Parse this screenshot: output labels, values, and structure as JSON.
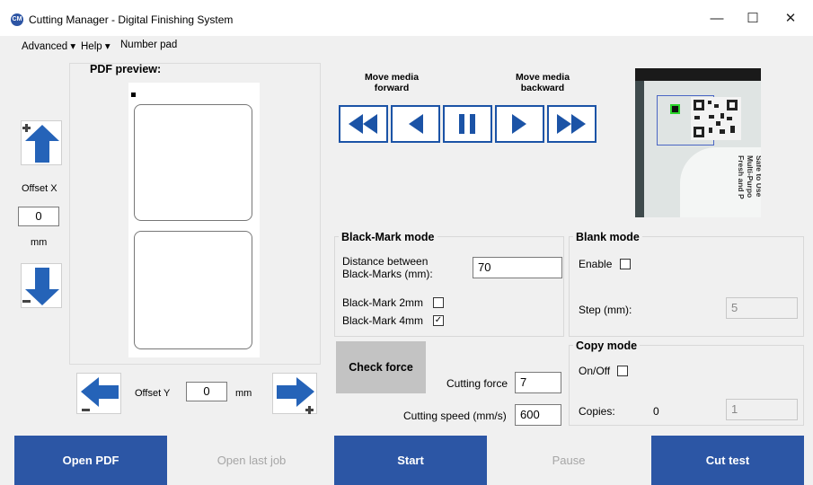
{
  "window": {
    "app_icon_text": "CM",
    "title": "Cutting Manager - Digital Finishing System",
    "minimize": "—",
    "maximize": "☐",
    "close": "✕"
  },
  "menu": {
    "advanced": "Advanced ▾",
    "help": "Help ▾",
    "number_pad": "Number pad"
  },
  "preview": {
    "label": "PDF preview:"
  },
  "offset_x": {
    "label": "Offset X",
    "value": "0",
    "unit": "mm"
  },
  "offset_y": {
    "label": "Offset Y",
    "value": "0",
    "unit": "mm"
  },
  "media": {
    "forward_label": "Move media\nforward",
    "backward_label": "Move media\nbackward"
  },
  "camera": {
    "sticker_text": "Safe to Use\nMulti-Purpo\nFresh and P"
  },
  "blackmark": {
    "title": "Black-Mark mode",
    "distance_label": "Distance between\nBlack-Marks (mm):",
    "distance_value": "70",
    "mark2_label": "Black-Mark 2mm",
    "mark2_checked": false,
    "mark4_label": "Black-Mark 4mm",
    "mark4_checked": true
  },
  "blank": {
    "title": "Blank mode",
    "enable_label": "Enable",
    "step_label": "Step (mm):",
    "step_value": "5"
  },
  "copy": {
    "title": "Copy mode",
    "onoff_label": "On/Off",
    "copies_label": "Copies:",
    "copies_count": "0",
    "copies_value": "1"
  },
  "force": {
    "check_label": "Check force",
    "cutting_force_label": "Cutting force",
    "cutting_force_value": "7",
    "cutting_speed_label": "Cutting speed (mm/s)",
    "cutting_speed_value": "600"
  },
  "bottom": {
    "open_pdf": "Open PDF",
    "open_last": "Open last job",
    "start": "Start",
    "pause": "Pause",
    "cut_test": "Cut test"
  },
  "colors": {
    "accent": "#2c56a5",
    "arrow_blue": "#2563b8"
  }
}
